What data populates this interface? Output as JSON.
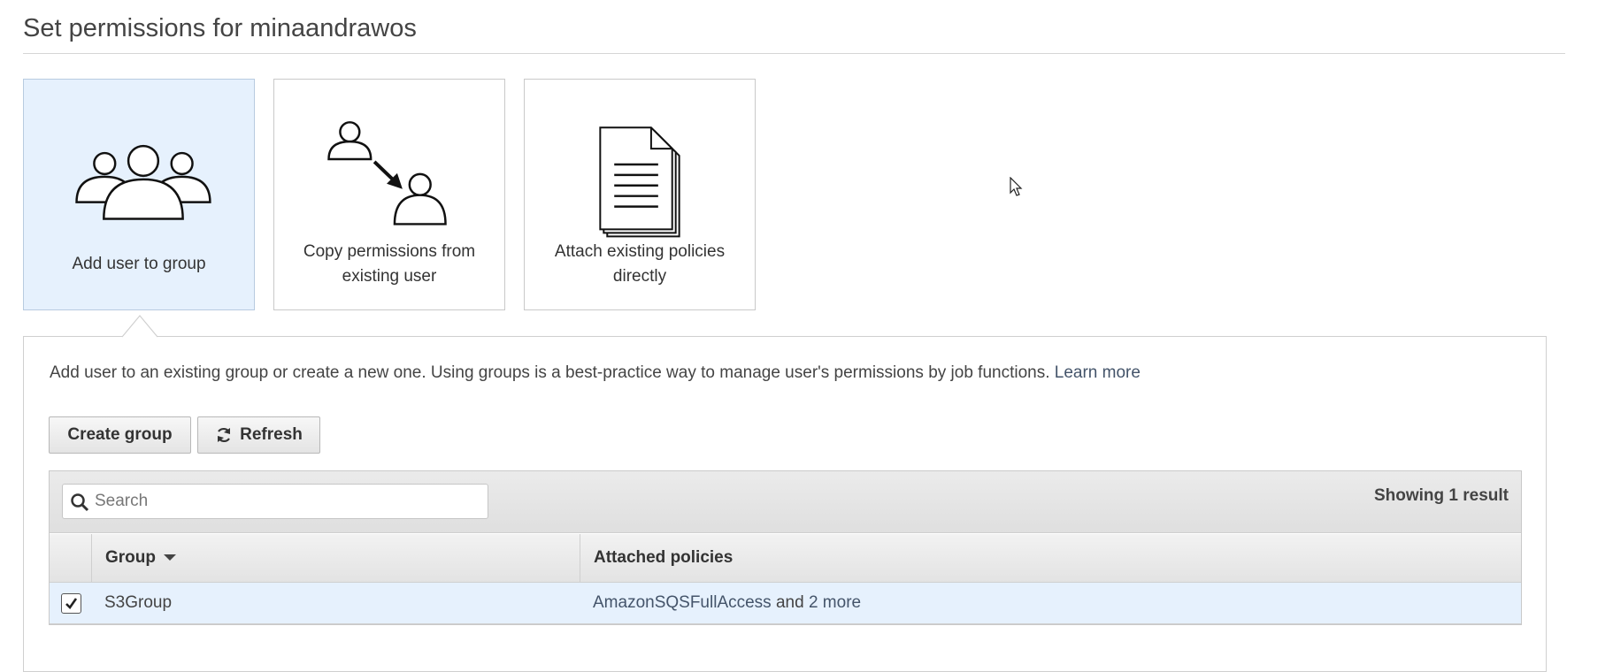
{
  "page": {
    "title": "Set permissions for minaandrawos"
  },
  "options": [
    {
      "label": "Add user to group",
      "icon": "group-users-icon",
      "selected": true
    },
    {
      "label": "Copy permissions from existing user",
      "icon": "copy-user-permissions-icon",
      "selected": false
    },
    {
      "label": "Attach existing policies directly",
      "icon": "policy-document-icon",
      "selected": false
    }
  ],
  "panel": {
    "description": "Add user to an existing group or create a new one. Using groups is a best-practice way to manage user's permissions by job functions.",
    "learn_more": "Learn more",
    "create_group_label": "Create group",
    "refresh_label": "Refresh"
  },
  "table": {
    "search_placeholder": "Search",
    "result_count": "Showing 1 result",
    "columns": [
      "Group",
      "Attached policies"
    ],
    "rows": [
      {
        "checked": true,
        "group": "S3Group",
        "policy": "AmazonSQSFullAccess",
        "and_text": "and",
        "more": "2 more"
      }
    ]
  },
  "colors": {
    "selected_bg": "#e6f1fd",
    "link": "#44546a",
    "border": "#c9c9c9"
  }
}
